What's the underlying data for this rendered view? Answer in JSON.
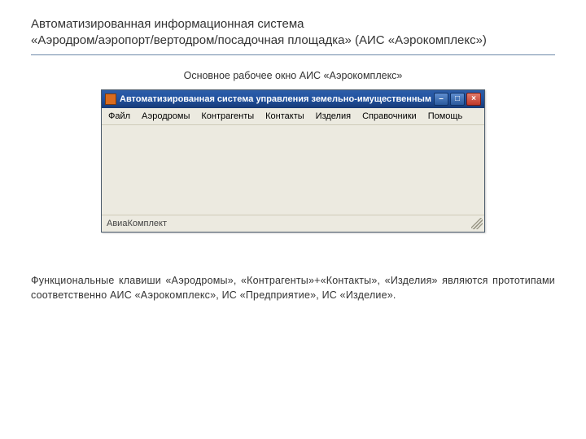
{
  "slide": {
    "title_line1": "Автоматизированная информационная система",
    "title_line2": " «Аэродром/аэропорт/вертодром/посадочная площадка» (АИС «Аэрокомплекс»)",
    "caption": "Основное рабочее окно АИС «Аэрокомплекс»",
    "body_text": "Функциональные клавиши «Аэродромы», «Контрагенты»+«Контакты», «Изделия» являются прототипами соответственно АИС «Аэрокомплекс», ИС «Предприятие», ИС «Изделие»."
  },
  "window": {
    "title": "Автоматизированная система управления земельно-имущественным компл..",
    "menu": {
      "file": "Файл",
      "aerodromes": "Аэродромы",
      "contractors": "Контрагенты",
      "contacts": "Контакты",
      "products": "Изделия",
      "directories": "Справочники",
      "help": "Помощь"
    },
    "status": "АвиаКомплект",
    "buttons": {
      "minimize": "–",
      "maximize": "□",
      "close": "×"
    }
  }
}
